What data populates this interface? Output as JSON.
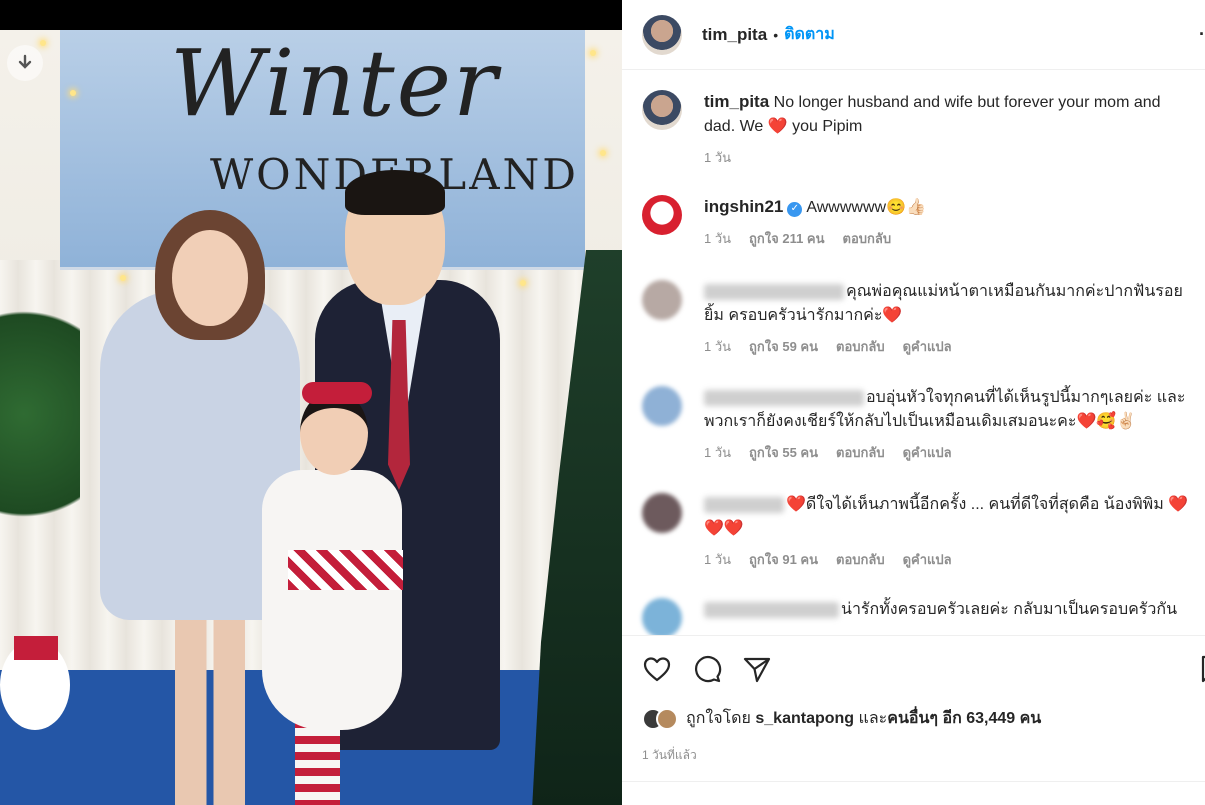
{
  "post": {
    "author": "tim_pita",
    "follow_label": "ติดตาม",
    "separator": "•",
    "more_label": "·",
    "caption_text": "No longer husband and wife but forever your mom and dad. We ❤️ you Pipim",
    "caption_time": "1 วัน"
  },
  "photo": {
    "banner_title": "Winter",
    "banner_subtitle": "WONDERLAND"
  },
  "comments": [
    {
      "user": "ingshin21",
      "verified": true,
      "text": "Awwwwww😊👍🏻",
      "time": "1 วัน",
      "likes": "ถูกใจ 211 คน",
      "reply": "ตอบกลับ",
      "translate": ""
    },
    {
      "user": "",
      "text": "คุณพ่อคุณแม่หน้าตาเหมือนกันมากค่ะปากฟันรอยยิ้ม ครอบครัวน่ารักมากค่ะ❤️",
      "time": "1 วัน",
      "likes": "ถูกใจ 59 คน",
      "reply": "ตอบกลับ",
      "translate": "ดูคำแปล"
    },
    {
      "user": "",
      "text": "อบอุ่นหัวใจทุกคนที่ได้เห็นรูปนี้มากๆเลยค่ะ และพวกเราก็ยังคงเชียร์ให้กลับไปเป็นเหมือนเดิมเสมอนะคะ❤️🥰✌🏻",
      "time": "1 วัน",
      "likes": "ถูกใจ 55 คน",
      "reply": "ตอบกลับ",
      "translate": "ดูคำแปล"
    },
    {
      "user": "",
      "text": "❤️ดีใจได้เห็นภาพนี้อีกครั้ง ... คนที่ดีใจที่สุดคือ น้องพิพิม ❤️❤️❤️",
      "time": "1 วัน",
      "likes": "ถูกใจ 91 คน",
      "reply": "ตอบกลับ",
      "translate": "ดูคำแปล"
    },
    {
      "user": "",
      "text": "น่ารักทั้งครอบครัวเลยค่ะ กลับมาเป็นครอบครัวกัน",
      "time": "",
      "likes": "",
      "reply": "",
      "translate": ""
    }
  ],
  "actions": {
    "like_icon": "heart-icon",
    "comment_icon": "comment-icon",
    "share_icon": "share-icon",
    "save_icon": "bookmark-icon"
  },
  "likes": {
    "prefix": "ถูกใจโดย",
    "first_user": "s_kantapong",
    "joiner": "และ",
    "others": "คนอื่นๆ อีก 63,449 คน"
  },
  "timestamp": "1 วันที่แล้ว",
  "colors": {
    "accent": "#0095f6",
    "verified": "#3897f0",
    "heart": "#e0202f",
    "muted": "#8e8e8e"
  }
}
